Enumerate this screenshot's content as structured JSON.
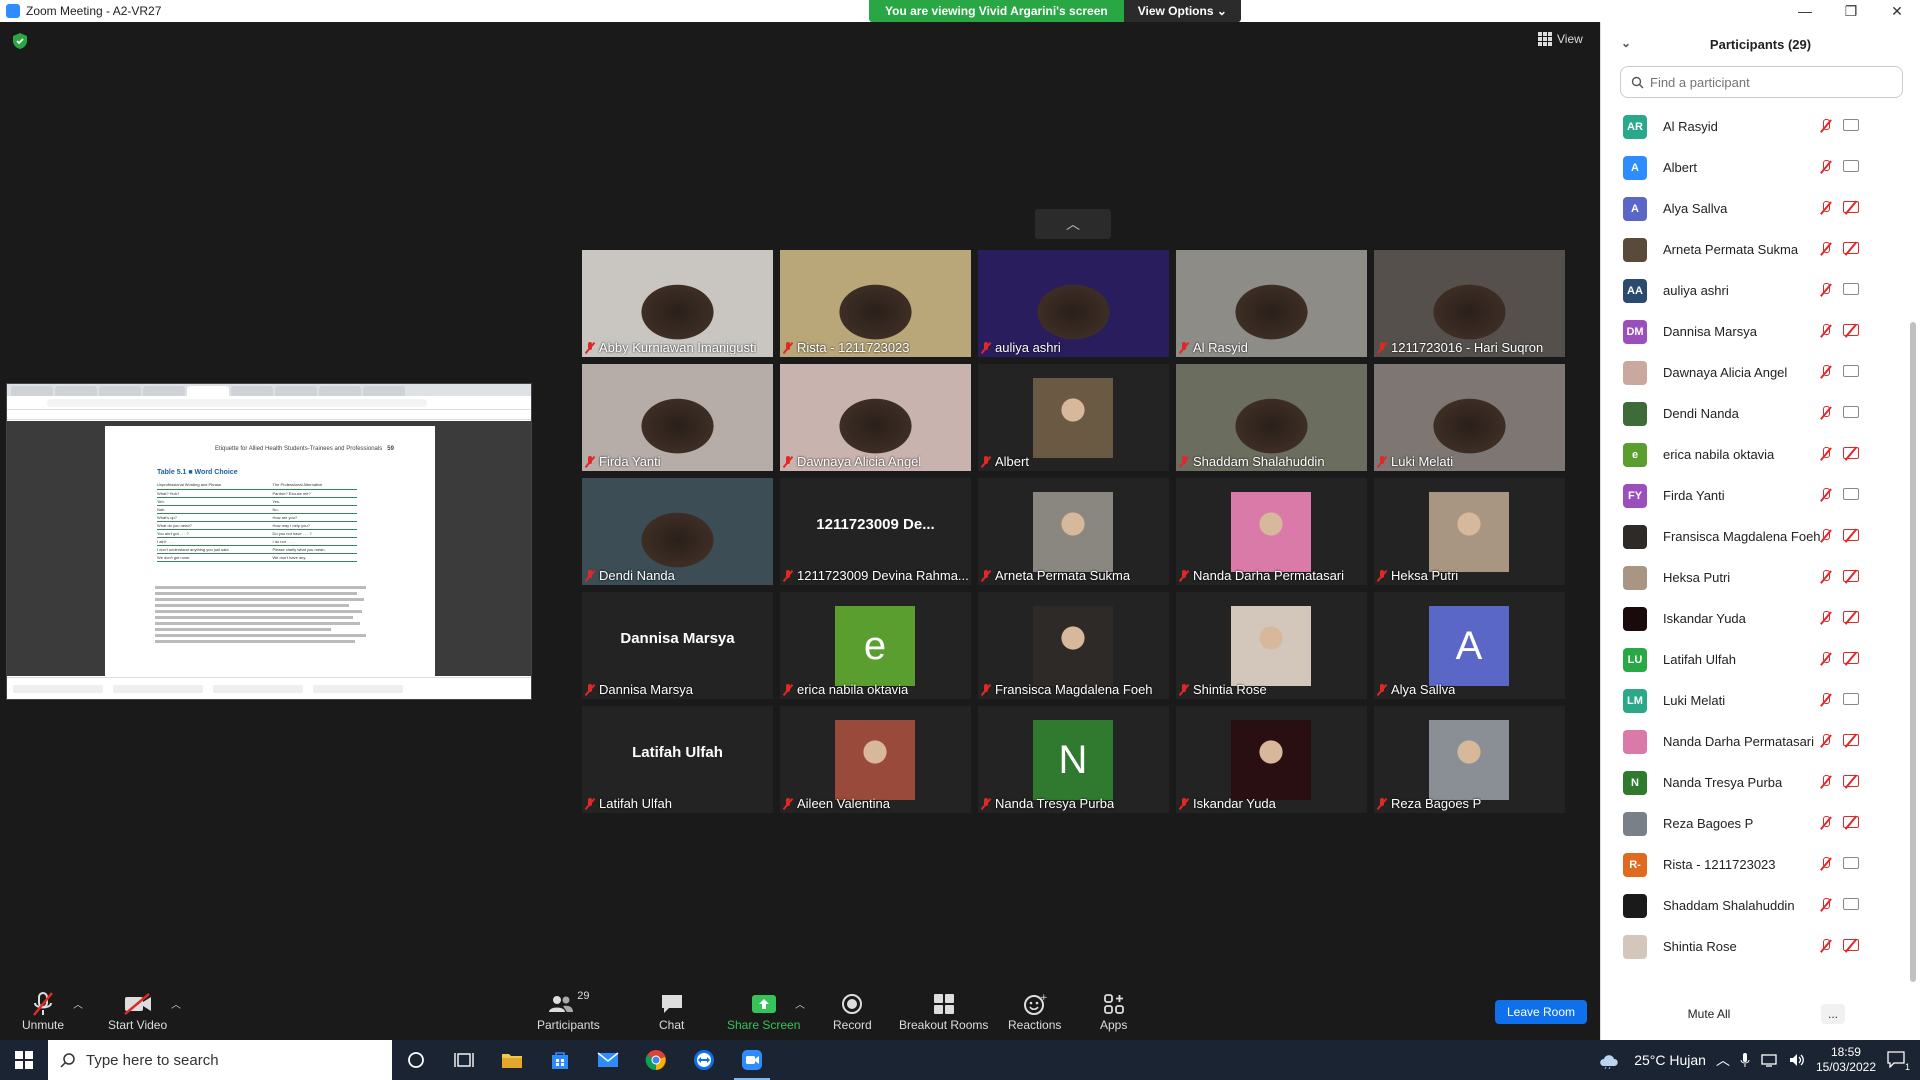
{
  "window": {
    "title": "Zoom Meeting - A2-VR27"
  },
  "banner": {
    "viewing": "You are viewing Vivid Argarini's screen",
    "options": "View Options"
  },
  "view": {
    "label": "View"
  },
  "shared_screen": {
    "doc_header": "Etiquette for Allied Health Students-Trainees and Professionals",
    "page_num": "59",
    "table_title": "Table 5.1 ■ Word Choice",
    "columns": [
      "Unprofessional Wording and Phrase",
      "The Professional Alternative"
    ],
    "rows": [
      [
        "What? Huh?",
        "Pardon? Excuse me?"
      ],
      [
        "Yeh.",
        "Yes."
      ],
      [
        "Nah.",
        "No."
      ],
      [
        "What's up?",
        "How are you?"
      ],
      [
        "What do you need?",
        "How may I help you?"
      ],
      [
        "You ain't got . . . ?",
        "Do you not have . . . ?"
      ],
      [
        "I ain't . . .",
        "I do not . . ."
      ],
      [
        "I don't understand anything you just said.",
        "Please clarify what you mean."
      ],
      [
        "We don't got none.",
        "We don't have any."
      ]
    ]
  },
  "tiles": [
    {
      "name": "Abby Kurniawan Imanigusti",
      "kind": "video",
      "color": "#c9c6c2"
    },
    {
      "name": "Rista - 1211723023",
      "kind": "video",
      "color": "#b9a679"
    },
    {
      "name": "auliya ashri",
      "kind": "video",
      "color": "#2a1d5e"
    },
    {
      "name": "Al Rasyid",
      "kind": "video",
      "color": "#8d8c86"
    },
    {
      "name": "1211723016 - Hari Suqron",
      "kind": "video",
      "color": "#55504b"
    },
    {
      "name": "Firda Yanti",
      "kind": "video",
      "color": "#b7ada8"
    },
    {
      "name": "Dawnaya Alicia Angel",
      "kind": "video",
      "color": "#c8b3ae"
    },
    {
      "name": "Albert",
      "kind": "photo",
      "color": "#6a5a44"
    },
    {
      "name": "Shaddam Shalahuddin",
      "kind": "video",
      "color": "#6b6d5f"
    },
    {
      "name": "Luki Melati",
      "kind": "video",
      "color": "#7d7672"
    },
    {
      "name": "Dendi Nanda",
      "kind": "video",
      "color": "#3c4d55"
    },
    {
      "name": "1211723009 Devina Rahma...",
      "kind": "text",
      "big": "1211723009 De..."
    },
    {
      "name": "Arneta Permata Sukma",
      "kind": "photo",
      "color": "#8a8680"
    },
    {
      "name": "Nanda Darha Permatasari",
      "kind": "photo",
      "color": "#d97aa8"
    },
    {
      "name": "Heksa Putri",
      "kind": "photo",
      "color": "#a89582"
    },
    {
      "name": "Dannisa Marsya",
      "kind": "text",
      "big": "Dannisa Marsya"
    },
    {
      "name": "erica nabila oktavia",
      "kind": "letter",
      "letter": "e",
      "color": "#5a9e30"
    },
    {
      "name": "Fransisca Magdalena Foeh",
      "kind": "photo",
      "color": "#2e2a28"
    },
    {
      "name": "Shintia Rose",
      "kind": "photo",
      "color": "#d2c7ba"
    },
    {
      "name": "Alya Sallva",
      "kind": "letter",
      "letter": "A",
      "color": "#5b67c6"
    },
    {
      "name": "Latifah Ulfah",
      "kind": "text",
      "big": "Latifah Ulfah"
    },
    {
      "name": "Aileen Valentina",
      "kind": "photo",
      "color": "#9a4a3a"
    },
    {
      "name": "Nanda Tresya Purba",
      "kind": "letter",
      "letter": "N",
      "color": "#2f7a2e"
    },
    {
      "name": "Iskandar Yuda",
      "kind": "photo",
      "color": "#2a0f12"
    },
    {
      "name": "Reza Bagoes P",
      "kind": "photo",
      "color": "#8a8f95"
    }
  ],
  "toolbar": {
    "unmute": "Unmute",
    "start_video": "Start Video",
    "participants": "Participants",
    "participants_count": "29",
    "chat": "Chat",
    "share_screen": "Share Screen",
    "record": "Record",
    "breakout_rooms": "Breakout Rooms",
    "reactions": "Reactions",
    "apps": "Apps",
    "leave_room": "Leave Room"
  },
  "panel": {
    "title": "Participants (29)",
    "search_placeholder": "Find a participant",
    "mute_all": "Mute All",
    "more": "...",
    "participants": [
      {
        "initials": "AR",
        "name": "Al Rasyid",
        "color": "#2aa88a",
        "video_off": false
      },
      {
        "initials": "A",
        "name": "Albert",
        "color": "#2d8cff",
        "video_off": false
      },
      {
        "initials": "A",
        "name": "Alya Sallva",
        "color": "#5b67c6",
        "video_off": true
      },
      {
        "initials": "",
        "name": "Arneta Permata Sukma",
        "color": "#5a4a3a",
        "video_off": true
      },
      {
        "initials": "AA",
        "name": "auliya ashri",
        "color": "#2c4a6e",
        "video_off": false
      },
      {
        "initials": "DM",
        "name": "Dannisa Marsya",
        "color": "#9b4fbd",
        "video_off": true
      },
      {
        "initials": "",
        "name": "Dawnaya Alicia Angel",
        "color": "#c9a8a0",
        "video_off": false
      },
      {
        "initials": "",
        "name": "Dendi Nanda",
        "color": "#3d6b3a",
        "video_off": false
      },
      {
        "initials": "e",
        "name": "erica nabila oktavia",
        "color": "#5a9e30",
        "video_off": true
      },
      {
        "initials": "FY",
        "name": "Firda Yanti",
        "color": "#9b4fbd",
        "video_off": false
      },
      {
        "initials": "",
        "name": "Fransisca Magdalena Foeh",
        "color": "#2e2a28",
        "video_off": true
      },
      {
        "initials": "",
        "name": "Heksa Putri",
        "color": "#a89582",
        "video_off": true
      },
      {
        "initials": "",
        "name": "Iskandar Yuda",
        "color": "#1a0a0c",
        "video_off": true
      },
      {
        "initials": "LU",
        "name": "Latifah Ulfah",
        "color": "#2aa845",
        "video_off": true
      },
      {
        "initials": "LM",
        "name": "Luki Melati",
        "color": "#2aa88a",
        "video_off": false
      },
      {
        "initials": "",
        "name": "Nanda Darha Permatasari",
        "color": "#d97aa8",
        "video_off": true
      },
      {
        "initials": "N",
        "name": "Nanda Tresya Purba",
        "color": "#2f7a2e",
        "video_off": true
      },
      {
        "initials": "",
        "name": "Reza Bagoes P",
        "color": "#7a8088",
        "video_off": true
      },
      {
        "initials": "R-",
        "name": "Rista - 1211723023",
        "color": "#e06a1f",
        "video_off": false
      },
      {
        "initials": "",
        "name": "Shaddam Shalahuddin",
        "color": "#1a1a1a",
        "video_off": false
      },
      {
        "initials": "",
        "name": "Shintia Rose",
        "color": "#d2c7ba",
        "video_off": true
      }
    ]
  },
  "taskbar": {
    "search_placeholder": "Type here to search",
    "weather": "25°C  Hujan",
    "time": "18:59",
    "date": "15/03/2022",
    "notifications": "1"
  }
}
